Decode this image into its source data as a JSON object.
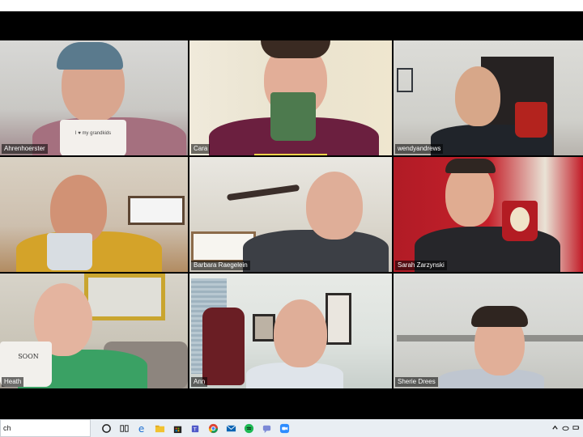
{
  "participants": [
    {
      "name": "Ahrenhoerster"
    },
    {
      "name": "Cara"
    },
    {
      "name": "wendyandrews"
    },
    {
      "name": ""
    },
    {
      "name": "Barbara Raegelein"
    },
    {
      "name": "Sarah Zarzynski"
    },
    {
      "name": "Heath"
    },
    {
      "name": "Ann"
    },
    {
      "name": "Sherie Drees"
    }
  ],
  "mug_texts": {
    "mug1": "I ♥ my grandkids",
    "mug7": "SOON"
  },
  "taskbar": {
    "search_text": "ch",
    "icons": [
      "task-view-icon",
      "edge-icon",
      "file-explorer-icon",
      "store-icon",
      "teams-icon",
      "chrome-icon",
      "mail-icon",
      "spotify-icon",
      "chat-icon",
      "zoom-icon"
    ]
  },
  "colors": {
    "active_speaker_border": "#e8e36a",
    "talk_indicator": "#f3d34a"
  }
}
